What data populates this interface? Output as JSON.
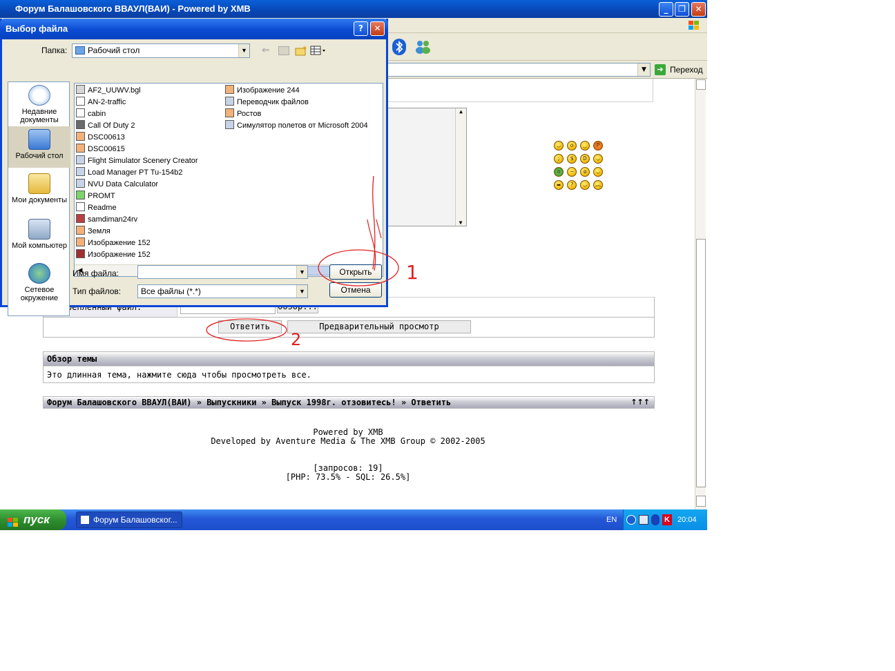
{
  "browser": {
    "title": "Форум Балашовского ВВАУЛ(ВАИ) - Powered by XMB",
    "go_label": "Переход"
  },
  "dialog": {
    "title": "Выбор файла",
    "help": "?",
    "close": "✕",
    "folder_label": "Папка:",
    "folder_value": "Рабочий стол",
    "places": [
      {
        "label": "Недавние документы"
      },
      {
        "label": "Рабочий стол"
      },
      {
        "label": "Мои документы"
      },
      {
        "label": "Мой компьютер"
      },
      {
        "label": "Сетевое окружение"
      }
    ],
    "files_col1": [
      "AF2_UUWV.bgl",
      "AN-2-traffic",
      "cabin",
      "Call Of Duty 2",
      "DSC00613",
      "DSC00615",
      "Flight Simulator Scenery Creator",
      "Load Manager PT Tu-154b2",
      "NVU Data Calculator",
      "PROMT",
      "Readme",
      "samdiman24rv",
      "Земля",
      "Изображение 152",
      "Изображение 152"
    ],
    "files_col2": [
      "Изображение 244",
      "Переводчик файлов",
      "Ростов",
      "Симулятор полетов от Microsoft 2004"
    ],
    "filename_label": "Имя файла:",
    "filename_value": "",
    "filetype_label": "Тип файлов:",
    "filetype_value": "Все файлы (*.*)",
    "open_button": "Открыть",
    "cancel_button": "Отмена"
  },
  "annotations": {
    "mark_1": "1",
    "mark_2": "2"
  },
  "forum": {
    "attach_label": "Прекрепленный файл:",
    "browse_button": "Обзор...",
    "reply_button": "Ответить",
    "preview_button": "Предварительный просмотр",
    "overview_header": "Обзор темы",
    "overview_text": "Это длинная тема, нажмите сюда чтобы просмотреть все.",
    "breadcrumb": "Форум Балашовского ВВАУЛ(ВАИ)  » Выпускники » Выпуск 1998г. отзовитесь! » Ответить",
    "breadcrumb_arrows": "↑↑↑",
    "footer_line1": "Powered by XMB",
    "footer_line2": "Developed by Aventure Media & The XMB Group © 2002-2005",
    "queries": "[запросов: 19]",
    "timing": "[PHP: 73.5% - SQL: 26.5%]"
  },
  "taskbar": {
    "start_label": "пуск",
    "task_label": "Форум Балашовског...",
    "lang": "EN",
    "clock": "20:04"
  }
}
